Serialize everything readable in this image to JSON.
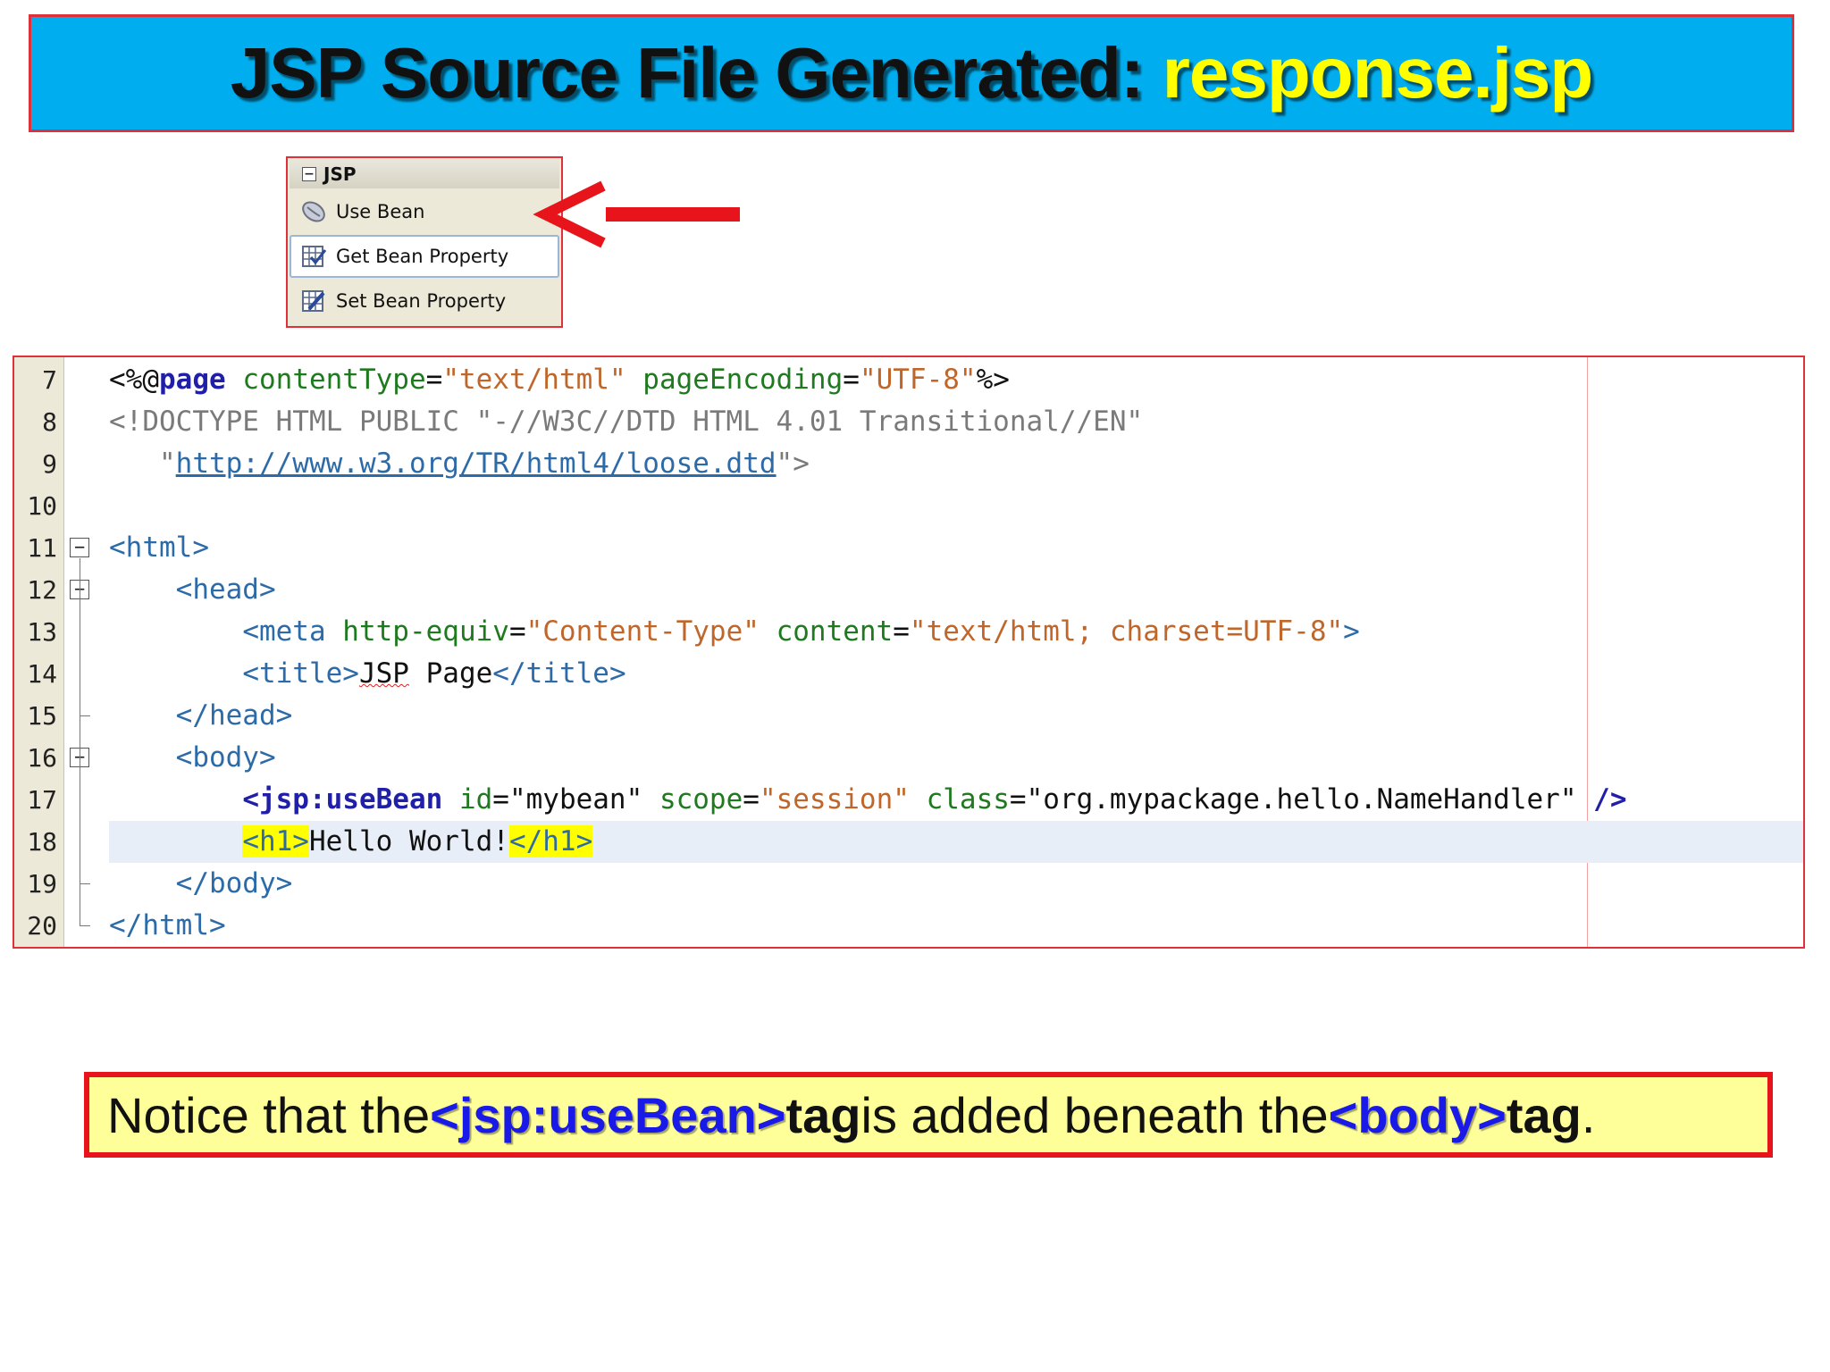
{
  "title": {
    "main": "JSP Source File Generated: ",
    "file": "response.jsp"
  },
  "palette": {
    "header": "JSP",
    "items": [
      {
        "label": "Use Bean",
        "icon": "bean-icon"
      },
      {
        "label": "Get Bean Property",
        "icon": "get-property-icon"
      },
      {
        "label": "Set Bean Property",
        "icon": "set-property-icon"
      }
    ]
  },
  "editor": {
    "line_numbers": [
      "7",
      "8",
      "9",
      "10",
      "11",
      "12",
      "13",
      "14",
      "15",
      "16",
      "17",
      "18",
      "19",
      "20"
    ],
    "lines": [
      [
        [
          "pl",
          "<%@"
        ],
        [
          "kw",
          "page"
        ],
        [
          "pl",
          " "
        ],
        [
          "at",
          "contentType"
        ],
        [
          "pl",
          "="
        ],
        [
          "st",
          "\"text/html\""
        ],
        [
          "pl",
          " "
        ],
        [
          "at",
          "pageEncoding"
        ],
        [
          "pl",
          "="
        ],
        [
          "st",
          "\"UTF-8\""
        ],
        [
          "pl",
          "%>"
        ]
      ],
      [
        [
          "dt",
          "<!DOCTYPE HTML PUBLIC \"-//W3C//DTD HTML 4.01 Transitional//EN\""
        ]
      ],
      [
        [
          "dt",
          "   \""
        ],
        [
          "lk",
          "http://www.w3.org/TR/html4/loose.dtd"
        ],
        [
          "dt",
          "\">"
        ]
      ],
      [],
      [
        [
          "tg",
          "<html>"
        ]
      ],
      [
        [
          "pl",
          "    "
        ],
        [
          "tg",
          "<head>"
        ]
      ],
      [
        [
          "pl",
          "        "
        ],
        [
          "tg",
          "<meta "
        ],
        [
          "at",
          "http-equiv"
        ],
        [
          "pl",
          "="
        ],
        [
          "st",
          "\"Content-Type\""
        ],
        [
          "pl",
          " "
        ],
        [
          "at",
          "content"
        ],
        [
          "pl",
          "="
        ],
        [
          "st",
          "\"text/html; charset=UTF-8\""
        ],
        [
          "tg",
          ">"
        ]
      ],
      [
        [
          "pl",
          "        "
        ],
        [
          "tg",
          "<title>"
        ],
        [
          "sq",
          "JSP"
        ],
        [
          "pl",
          " Page"
        ],
        [
          "tg",
          "</title>"
        ]
      ],
      [
        [
          "pl",
          "    "
        ],
        [
          "tg",
          "</head>"
        ]
      ],
      [
        [
          "pl",
          "    "
        ],
        [
          "tg",
          "<body>"
        ]
      ],
      [
        [
          "pl",
          "        "
        ],
        [
          "kw",
          "<jsp:useBean"
        ],
        [
          "pl",
          " "
        ],
        [
          "at",
          "id"
        ],
        [
          "pl",
          "="
        ],
        [
          "pl",
          "\"mybean\""
        ],
        [
          "pl",
          " "
        ],
        [
          "at",
          "scope"
        ],
        [
          "pl",
          "="
        ],
        [
          "st",
          "\"session\""
        ],
        [
          "pl",
          " "
        ],
        [
          "at",
          "class"
        ],
        [
          "pl",
          "="
        ],
        [
          "pl",
          "\"org.mypackage.hello.NameHandler\""
        ],
        [
          "pl",
          " "
        ],
        [
          "kw",
          "/>"
        ]
      ],
      [
        [
          "pl",
          "        "
        ],
        [
          "hltg",
          "<h1>"
        ],
        [
          "pl",
          "Hello World!"
        ],
        [
          "hltg",
          "</h1>"
        ]
      ],
      [
        [
          "pl",
          "    "
        ],
        [
          "tg",
          "</body>"
        ]
      ],
      [
        [
          "tg",
          "</html>"
        ]
      ]
    ],
    "fold_open_lines": [
      4,
      5,
      9
    ],
    "fold_end_lines": [
      8,
      12,
      13
    ],
    "current_line_index": 11
  },
  "note": {
    "prefix": "Notice that the ",
    "tag1": "<jsp:useBean>",
    "word1": " tag",
    "middle": " is added beneath the ",
    "tag2": "<body>",
    "word2": " tag",
    "suffix": "."
  },
  "colors": {
    "banner": "#00AEEF",
    "frame_red": "#E0303A",
    "note_bg": "#FFFF99",
    "highlight": "#FFFF00"
  }
}
